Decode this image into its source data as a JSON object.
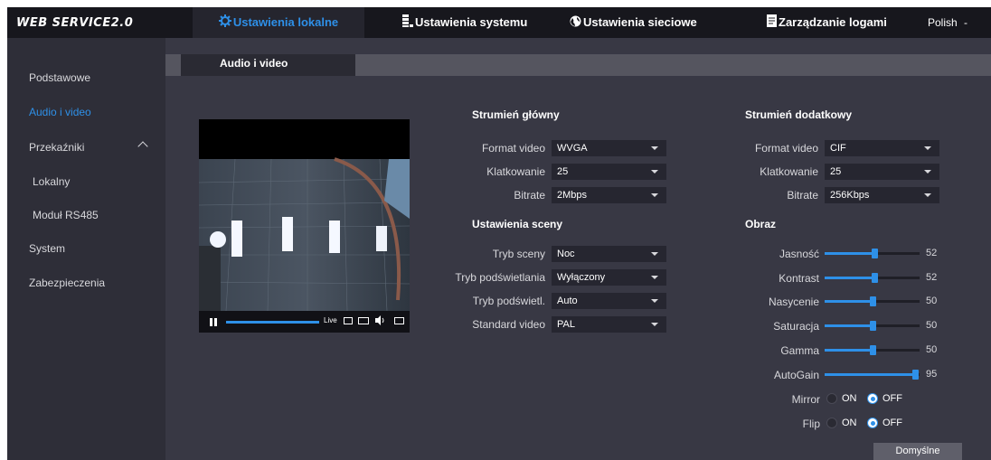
{
  "app": {
    "logo": "WEB SERVICE2.0"
  },
  "nav": {
    "local": "Ustawienia lokalne",
    "system": "Ustawienia systemu",
    "network": "Ustawienia sieciowe",
    "logs": "Zarządzanie logami",
    "language": "Polish",
    "language_arrow": "-"
  },
  "sidebar": {
    "items": [
      {
        "label": "Podstawowe"
      },
      {
        "label": "Audio i video"
      },
      {
        "label": "Przekaźniki"
      },
      {
        "label": "Lokalny"
      },
      {
        "label": "Moduł RS485"
      },
      {
        "label": "System"
      },
      {
        "label": "Zabezpieczenia"
      }
    ]
  },
  "tab": {
    "label": "Audio i video"
  },
  "player": {
    "live_label": "Live"
  },
  "main_stream": {
    "title": "Strumień główny",
    "fields": [
      {
        "label": "Format video",
        "value": "WVGA"
      },
      {
        "label": "Klatkowanie",
        "value": "25"
      },
      {
        "label": "Bitrate",
        "value": "2Mbps"
      }
    ]
  },
  "sub_stream": {
    "title": "Strumień dodatkowy",
    "fields": [
      {
        "label": "Format video",
        "value": "CIF"
      },
      {
        "label": "Klatkowanie",
        "value": "25"
      },
      {
        "label": "Bitrate",
        "value": "256Kbps"
      }
    ]
  },
  "scene": {
    "title": "Ustawienia sceny",
    "fields": [
      {
        "label": "Tryb sceny",
        "value": "Noc"
      },
      {
        "label": "Tryb podświetlania",
        "value": "Wyłączony"
      },
      {
        "label": "Tryb podświetl.",
        "value": "Auto"
      },
      {
        "label": "Standard video",
        "value": "PAL"
      }
    ]
  },
  "image": {
    "title": "Obraz",
    "sliders": [
      {
        "label": "Jasność",
        "value": 52,
        "fraction": 0.52
      },
      {
        "label": "Kontrast",
        "value": 52,
        "fraction": 0.52
      },
      {
        "label": "Nasycenie",
        "value": 50,
        "fraction": 0.5
      },
      {
        "label": "Saturacja",
        "value": 50,
        "fraction": 0.5
      },
      {
        "label": "Gamma",
        "value": 50,
        "fraction": 0.5
      },
      {
        "label": "AutoGain",
        "value": 95,
        "fraction": 0.95
      }
    ],
    "toggles": [
      {
        "label": "Mirror",
        "on_label": "ON",
        "off_label": "OFF",
        "selected": "OFF"
      },
      {
        "label": "Flip",
        "on_label": "ON",
        "off_label": "OFF",
        "selected": "OFF"
      }
    ]
  },
  "actions": {
    "default_label": "Domyślne"
  },
  "colors": {
    "accent": "#2e90e8",
    "panel": "#383844",
    "sidebar": "#2e2e38",
    "topbar": "#17171d"
  }
}
